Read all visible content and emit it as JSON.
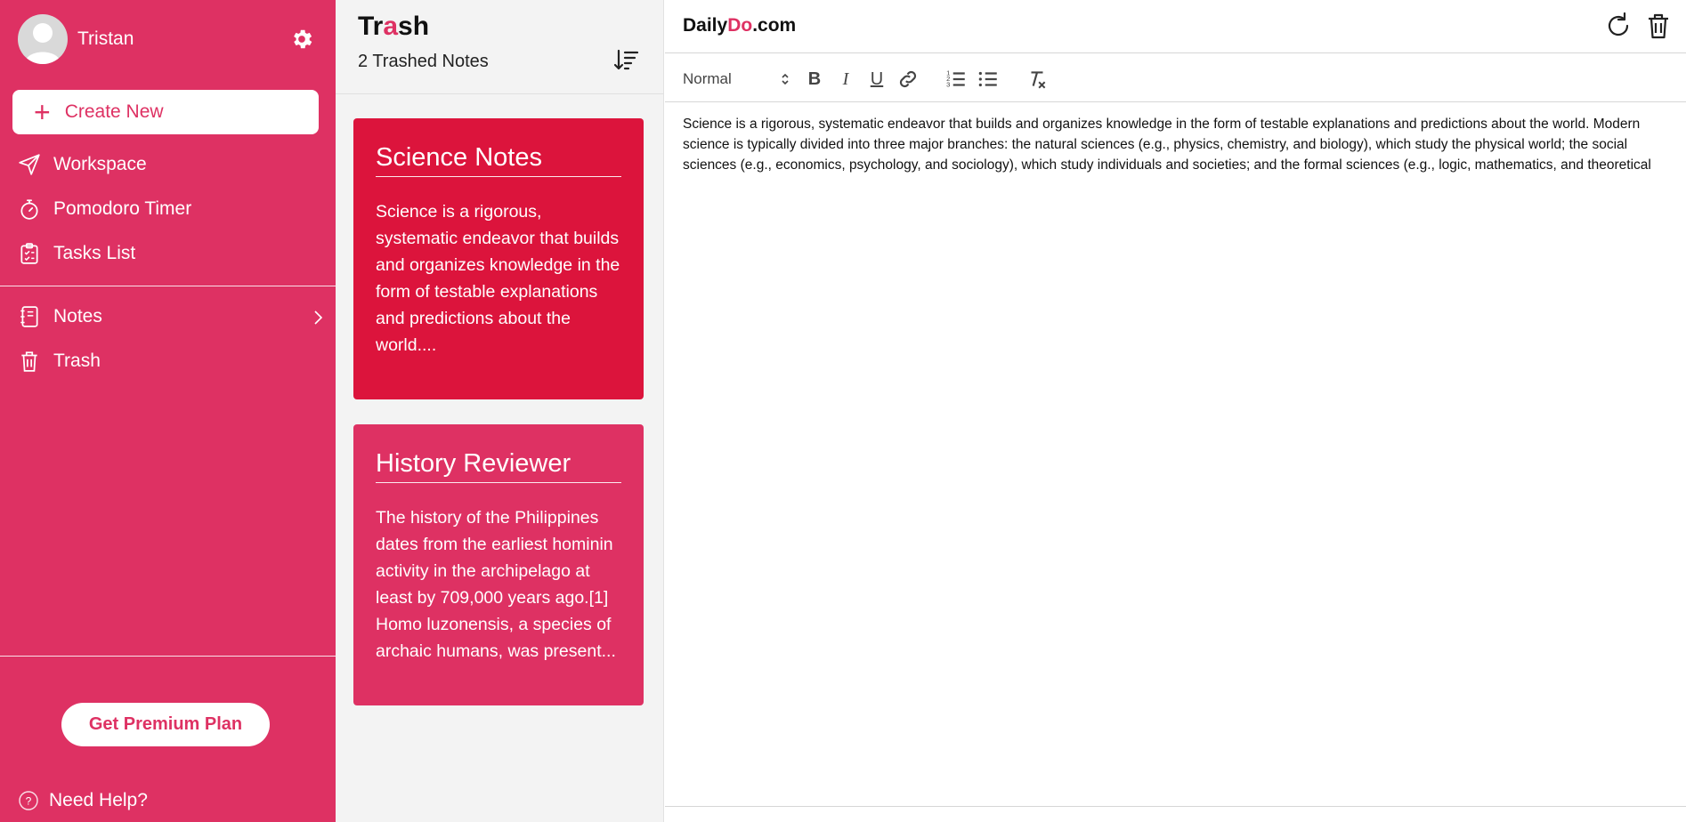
{
  "sidebar": {
    "username": "Tristan",
    "create_label": "Create New",
    "nav": [
      {
        "label": "Workspace",
        "icon": "send-icon"
      },
      {
        "label": "Pomodoro Timer",
        "icon": "stopwatch-icon"
      },
      {
        "label": "Tasks List",
        "icon": "clipboard-icon"
      },
      {
        "label": "Notes",
        "icon": "notebook-icon"
      },
      {
        "label": "Trash",
        "icon": "trash-icon"
      }
    ],
    "premium_label": "Get Premium Plan",
    "help_label": "Need Help?"
  },
  "list": {
    "title_pre": "Tr",
    "title_accent": "a",
    "title_post": "sh",
    "count": "2 Trashed Notes",
    "notes": [
      {
        "title": "Science Notes",
        "excerpt": "Science is a rigorous, systematic endeavor that builds and organizes knowledge in the form of testable explanations and predictions about the world....",
        "color": "#dc143c"
      },
      {
        "title": "History Reviewer",
        "excerpt": "The history of the Philippines dates from the earliest hominin activity in the archipelago at least by 709,000 years ago.[1] Homo luzonensis, a species of archaic humans, was present...",
        "color": "#de3163"
      }
    ]
  },
  "editor": {
    "brand_pre": "Daily",
    "brand_accent": "Do",
    "brand_post": ".com",
    "format": "Normal",
    "content": "Science is a rigorous, systematic endeavor that builds and organizes knowledge in the form of testable explanations and predictions about the world. Modern science is typically divided into three major branches: the natural sciences (e.g., physics, chemistry, and biology), which study the physical world; the social sciences (e.g., economics, psychology, and sociology), which study individuals and societies; and the formal sciences (e.g., logic, mathematics, and theoretical"
  },
  "colors": {
    "brand": "#de3163",
    "card_active": "#dc143c"
  }
}
